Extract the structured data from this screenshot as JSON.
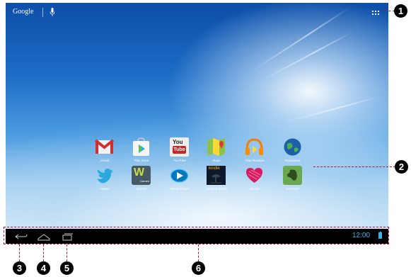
{
  "topbar": {
    "search_brand": "Google",
    "mic_icon": "mic-icon",
    "apps_icon": "all-apps-grid-icon"
  },
  "apps": [
    {
      "label": "Gmail",
      "icon": "gmail-icon"
    },
    {
      "label": "Play Store",
      "icon": "play-store-icon"
    },
    {
      "label": "YouTube",
      "icon": "youtube-icon",
      "icon_text": [
        "You",
        "Tube"
      ]
    },
    {
      "label": "Maps",
      "icon": "maps-icon"
    },
    {
      "label": "Play Musique",
      "icon": "play-music-icon"
    },
    {
      "label": "Navigateur",
      "icon": "browser-icon"
    },
    {
      "label": "Twitter",
      "icon": "twitter-icon"
    },
    {
      "label": "Games",
      "icon": "games-icon",
      "icon_text": "Games"
    },
    {
      "label": "Media Player",
      "icon": "media-player-icon"
    },
    {
      "label": "Amazon Kindle",
      "icon": "kindle-icon",
      "icon_text": "kindle"
    },
    {
      "label": "Sketch",
      "icon": "sketch-icon"
    },
    {
      "label": "Evernote",
      "icon": "evernote-icon"
    }
  ],
  "navbar": {
    "back_icon": "back-icon",
    "home_icon": "home-icon",
    "recents_icon": "recent-apps-icon",
    "time": "12:00",
    "battery_icon": "battery-icon"
  },
  "callouts": [
    "1",
    "2",
    "3",
    "4",
    "5",
    "6"
  ],
  "colors": {
    "callout_line": "#b0123a",
    "clock": "#33b5e5",
    "navbar": "#000000"
  }
}
